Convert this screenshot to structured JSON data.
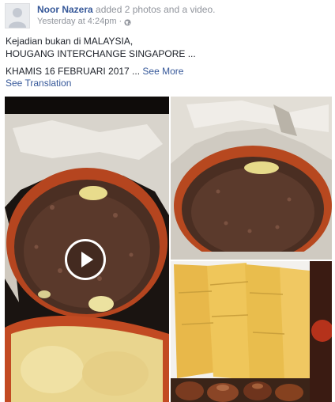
{
  "header": {
    "author": "Noor Nazera",
    "action": " added 2 photos and a video.",
    "timestamp": "Yesterday at 4:24pm",
    "separator": "·",
    "privacy_icon": "globe-icon"
  },
  "post": {
    "lines": [
      "Kejadian bukan di MALAYSIA,",
      "HOUGANG INTERCHANGE SINGAPORE ...",
      "KHAMIS 16 FEBRUARI 2017 ..."
    ],
    "see_more": "See More",
    "see_translation": "See Translation"
  },
  "media": {
    "video_play_icon": "play-icon",
    "items": [
      {
        "kind": "video"
      },
      {
        "kind": "photo"
      },
      {
        "kind": "photo"
      }
    ]
  },
  "colors": {
    "link": "#365899",
    "secondary_text": "#90949c",
    "primary_text": "#1d2129"
  }
}
